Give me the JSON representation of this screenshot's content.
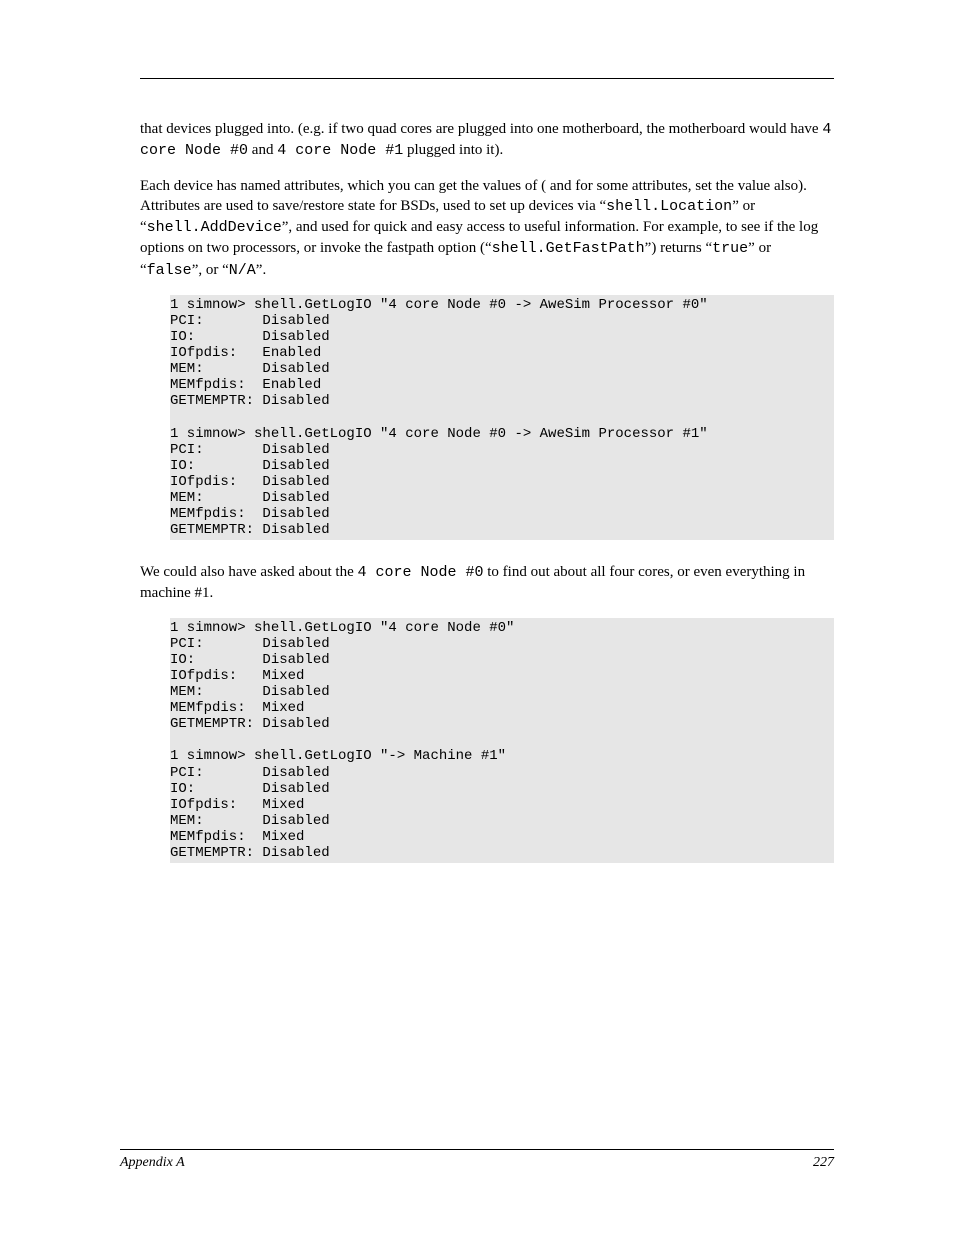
{
  "header": {
    "right_doc_title": ""
  },
  "p1": "that devices plugged into. (e.g. if two quad cores are plugged into one motherboard, the motherboard would have ",
  "p1_code1": "4 core Node #0",
  "p1_mid": " and ",
  "p1_code2": "4 core Node #1",
  "p1_end": " plugged into it).",
  "p2_a": "Each device has named attributes, which you can get the values of ( and for some attributes, set the value also). Attributes are used to save/restore state for BSDs, used to set up devices via ",
  "p2_q1": "shell.Location",
  "p2_mid1": " or ",
  "p2_q2": "shell.AddDevice",
  "p2_b": ", and used for quick and easy access to useful information. For example, to see if the log options on two processors, or invoke the fastpath option (",
  "p2_q3": "shell.GetFastPath",
  "p2_c": ") returns ",
  "p2_q4": "true",
  "p2_mid2": " or ",
  "p2_q5": "false",
  "p2_mid3": ", or ",
  "p2_q6": "N/A",
  "p2_d": ".",
  "code1": "1 simnow> shell.GetLogIO \"4 core Node #0 -> AweSim Processor #0\"\nPCI:       Disabled\nIO:        Disabled\nIOfpdis:   Enabled\nMEM:       Disabled\nMEMfpdis:  Enabled\nGETMEMPTR: Disabled\n\n1 simnow> shell.GetLogIO \"4 core Node #0 -> AweSim Processor #1\"\nPCI:       Disabled\nIO:        Disabled\nIOfpdis:   Disabled\nMEM:       Disabled\nMEMfpdis:  Disabled\nGETMEMPTR: Disabled",
  "p3_a": "We could also have asked about the ",
  "p3_code": "4 core Node #0",
  "p3_b": " to find out about all four cores, or even everything in machine #1.",
  "code2": "1 simnow> shell.GetLogIO \"4 core Node #0\"\nPCI:       Disabled\nIO:        Disabled\nIOfpdis:   Mixed\nMEM:       Disabled\nMEMfpdis:  Mixed\nGETMEMPTR: Disabled\n\n1 simnow> shell.GetLogIO \"-> Machine #1\"\nPCI:       Disabled\nIO:        Disabled\nIOfpdis:   Mixed\nMEM:       Disabled\nMEMfpdis:  Mixed\nGETMEMPTR: Disabled",
  "footer": {
    "left": "Appendix A",
    "right": "227"
  }
}
